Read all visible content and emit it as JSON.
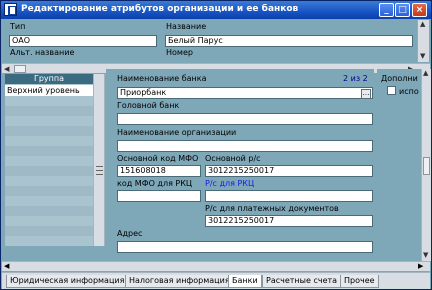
{
  "window": {
    "title": "Редактирование атрибутов организации и ее банков",
    "min_glyph": "_",
    "max_glyph": "□",
    "close_glyph": "×"
  },
  "header": {
    "type_label": "Тип",
    "type_value": "ОАО",
    "name_label": "Название",
    "name_value": "Белый Парус",
    "alt_name_label": "Альт. название",
    "number_label": "Номер"
  },
  "groups": {
    "header": "Группа",
    "items": [
      "Верхний уровень"
    ]
  },
  "bank_form": {
    "pager": "2 из 2",
    "bank_name_label": "Наименование банка",
    "bank_name_value": "Приорбанк",
    "ellipsis": "…",
    "head_bank_label": "Головной банк",
    "org_name_label": "Наименование организации",
    "mfo_label": "Основной код МФО",
    "mfo_value": "151608018",
    "account_label": "Основной р/с",
    "account_value": "3012215250017",
    "rkc_mfo_label": "код МФО для РКЦ",
    "rkc_account_label": "Р/с для РКЦ",
    "payment_account_label": "Р/с для платежных документов",
    "payment_account_value": "3012215250017",
    "address_label": "Адрес",
    "extra_label": "Дополни",
    "use_label": "испо"
  },
  "tabs": [
    {
      "label": "Юридическая информация",
      "active": false
    },
    {
      "label": "Налоговая информация",
      "active": false
    },
    {
      "label": "Банки",
      "active": true
    },
    {
      "label": "Расчетные счета",
      "active": false
    },
    {
      "label": "Прочее",
      "active": false
    }
  ],
  "colors": {
    "title_blue": "#1854c4",
    "panel": "#7ea7b8",
    "link_blue": "#1a1ae6"
  }
}
